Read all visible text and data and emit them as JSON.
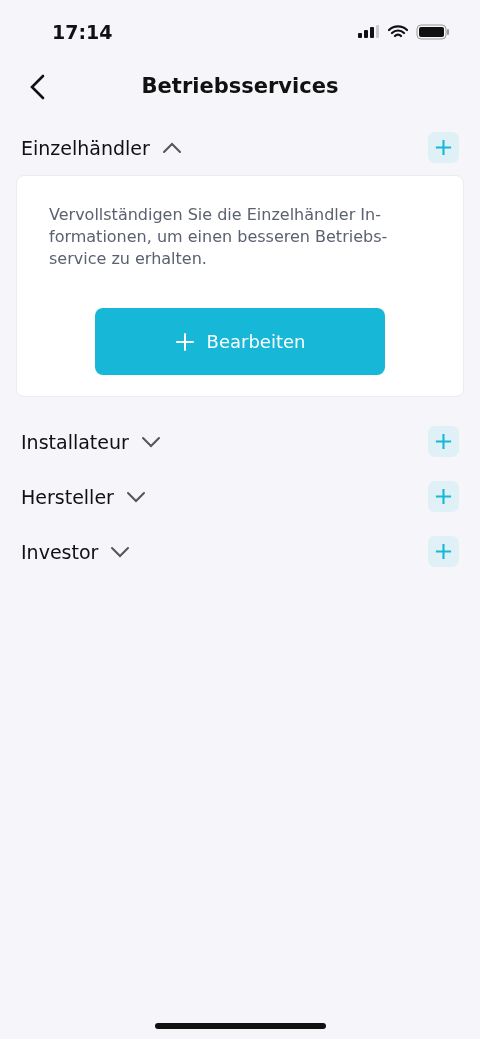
{
  "status_bar": {
    "time": "17:14"
  },
  "header": {
    "title": "Betriebsservices"
  },
  "sections": [
    {
      "title": "Einzelhändler",
      "expanded": true,
      "description_lines": [
        "Vervollständigen Sie die Einzelhändler In-",
        "formationen, um einen besseren Betriebs-",
        "service zu erhalten."
      ],
      "button": {
        "label": "Bearbeiten"
      }
    },
    {
      "title": "Installateur",
      "expanded": false
    },
    {
      "title": "Hersteller",
      "expanded": false
    },
    {
      "title": "Investor",
      "expanded": false
    }
  ]
}
